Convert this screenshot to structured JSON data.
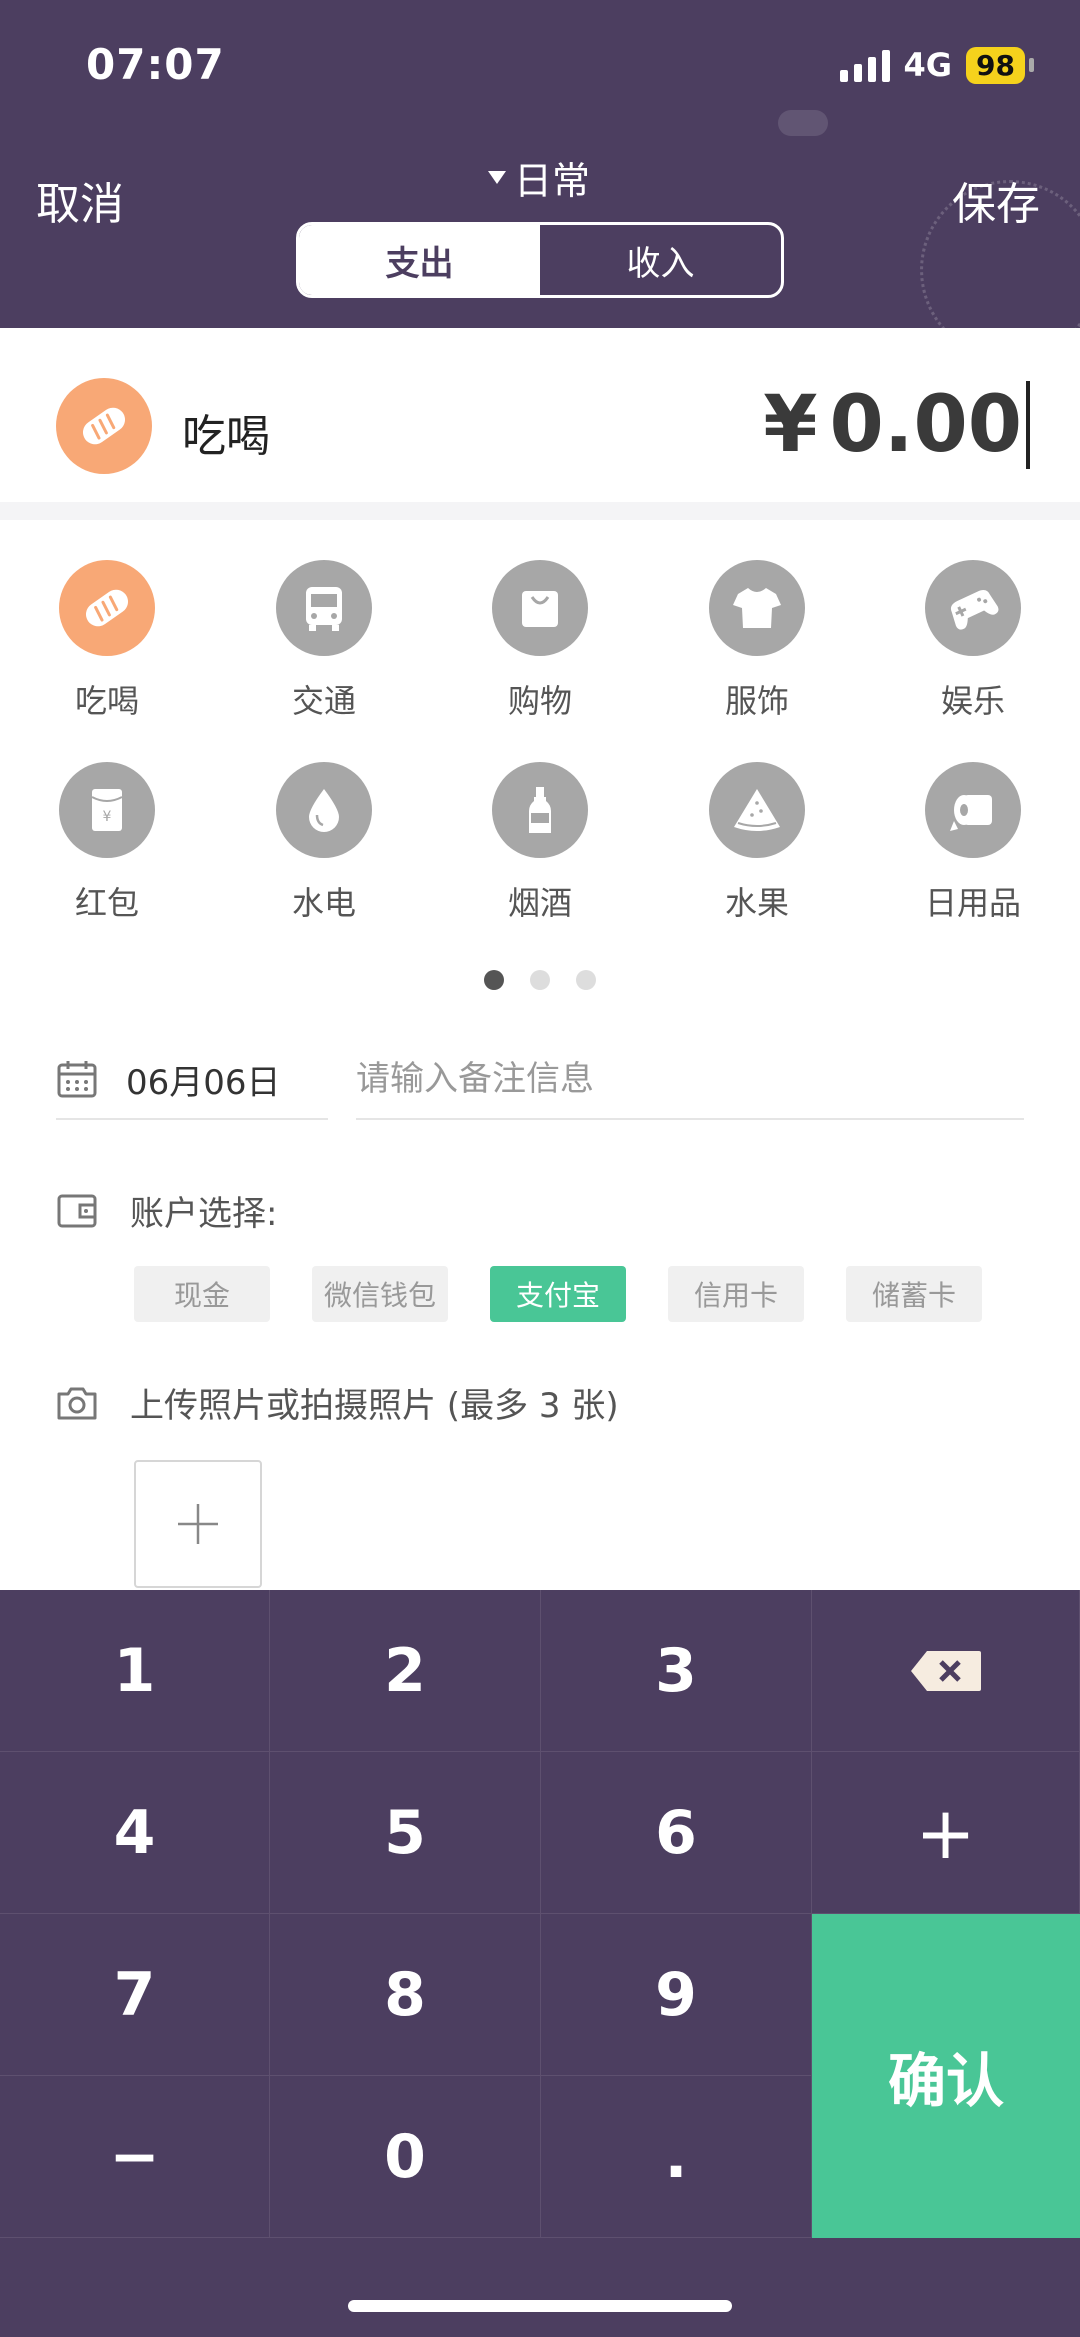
{
  "status_bar": {
    "time": "07:07",
    "network": "4G",
    "battery": "98"
  },
  "header": {
    "cancel_label": "取消",
    "save_label": "保存",
    "book_name": "日常",
    "tabs": [
      {
        "label": "支出",
        "active": true
      },
      {
        "label": "收入",
        "active": false
      }
    ]
  },
  "selected": {
    "category": "吃喝",
    "currency": "¥",
    "amount": "0.00"
  },
  "categories": [
    {
      "label": "吃喝",
      "icon": "bread-icon",
      "selected": true
    },
    {
      "label": "交通",
      "icon": "bus-icon",
      "selected": false
    },
    {
      "label": "购物",
      "icon": "shopping-bag-icon",
      "selected": false
    },
    {
      "label": "服饰",
      "icon": "tshirt-icon",
      "selected": false
    },
    {
      "label": "娱乐",
      "icon": "gamepad-icon",
      "selected": false
    },
    {
      "label": "红包",
      "icon": "red-envelope-icon",
      "selected": false
    },
    {
      "label": "水电",
      "icon": "water-drop-icon",
      "selected": false
    },
    {
      "label": "烟酒",
      "icon": "bottle-icon",
      "selected": false
    },
    {
      "label": "水果",
      "icon": "watermelon-icon",
      "selected": false
    },
    {
      "label": "日用品",
      "icon": "tissue-roll-icon",
      "selected": false
    }
  ],
  "pager": {
    "pages": 3,
    "current": 1
  },
  "form": {
    "date": "06月06日",
    "note_placeholder": "请输入备注信息",
    "account_label": "账户选择:",
    "accounts": [
      {
        "label": "现金",
        "selected": false
      },
      {
        "label": "微信钱包",
        "selected": false
      },
      {
        "label": "支付宝",
        "selected": true
      },
      {
        "label": "信用卡",
        "selected": false
      },
      {
        "label": "储蓄卡",
        "selected": false
      }
    ],
    "photo_label": "上传照片或拍摄照片 (最多 3 张)"
  },
  "keypad": {
    "keys": [
      "1",
      "2",
      "3",
      "4",
      "5",
      "6",
      "+",
      "7",
      "8",
      "9",
      "−",
      "0",
      "."
    ],
    "confirm_label": "确认"
  },
  "colors": {
    "header_bg": "#4c3e60",
    "accent_green": "#49c696",
    "accent_orange": "#f8a876",
    "icon_grey": "#a7a7a7"
  }
}
